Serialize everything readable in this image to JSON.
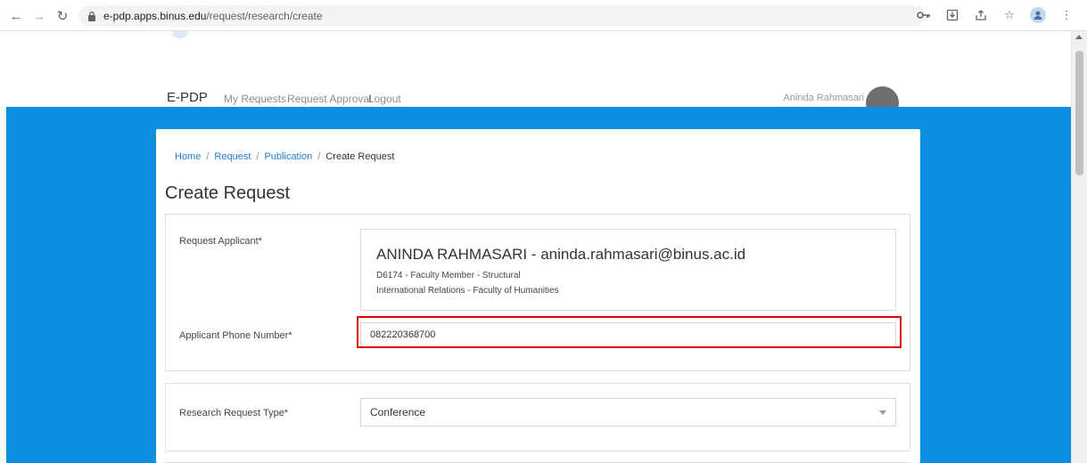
{
  "browser": {
    "url_host": "e-pdp.apps.binus.edu",
    "url_path": "/request/research/create",
    "icons": [
      "back-icon",
      "forward-icon",
      "reload-icon",
      "lock-icon",
      "key-icon",
      "install-icon",
      "share-icon",
      "star-icon",
      "profile-icon",
      "menu-icon"
    ]
  },
  "header": {
    "brand": "E-PDP",
    "nav": {
      "my_requests": "My Requests",
      "request_approval": "Request Approval",
      "logout": "Logout"
    },
    "user_name": "Aninda Rahmasari"
  },
  "breadcrumb": {
    "home": "Home",
    "request": "Request",
    "publication": "Publication",
    "current": "Create Request",
    "separator": "/"
  },
  "page": {
    "title": "Create Request"
  },
  "applicant": {
    "label": "Request Applicant*",
    "name_line": "ANINDA RAHMASARI - aninda.rahmasari@binus.ac.id",
    "detail_line1": "D6174 - Faculty Member - Structural",
    "detail_line2": "International Relations - Faculty of Humanities"
  },
  "phone": {
    "label": "Applicant Phone Number*",
    "value": "082220368700"
  },
  "research_type": {
    "label": "Research Request Type*",
    "selected": "Conference"
  },
  "colors": {
    "hero_blue": "#0d8fe0",
    "link_blue": "#1a7fd4",
    "highlight_red": "#e00000"
  }
}
